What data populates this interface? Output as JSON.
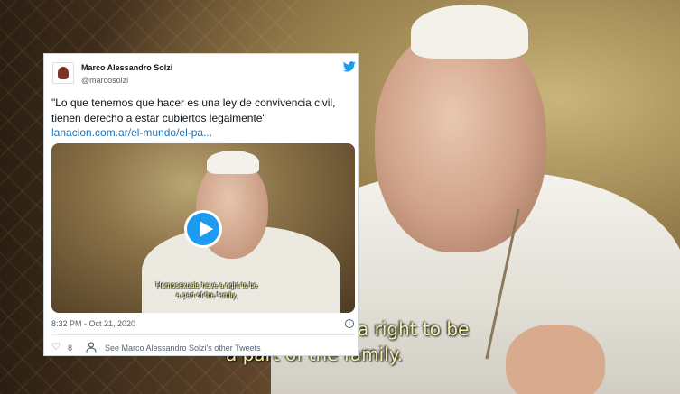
{
  "background_video": {
    "subtitle_line1": "a right to be",
    "subtitle_line2": "a part of the family."
  },
  "tweet": {
    "author_name": "Marco Alessandro Solzi",
    "author_handle": "@marcosolzi",
    "brand_icon": "twitter-bird-icon",
    "text": "\"Lo que tenemos que hacer es una ley de convivencia civil, tienen derecho a estar cubiertos legalmente\"",
    "link_text": "lanacion.com.ar/el-mundo/el-pa...",
    "media": {
      "subtitle_line1": "Homosexuals have a right to be",
      "subtitle_line2": "a part of the family.",
      "play_icon": "play-icon"
    },
    "timestamp": "8:32 PM - Oct 21, 2020",
    "info_glyph": "i",
    "like_glyph": "♡",
    "like_count": "8",
    "other_tweets_label": "See Marco Alessandro Solzi's other Tweets",
    "colors": {
      "accent": "#1d9bf0",
      "link": "#1b74b8",
      "secondary_text": "#536471"
    }
  }
}
